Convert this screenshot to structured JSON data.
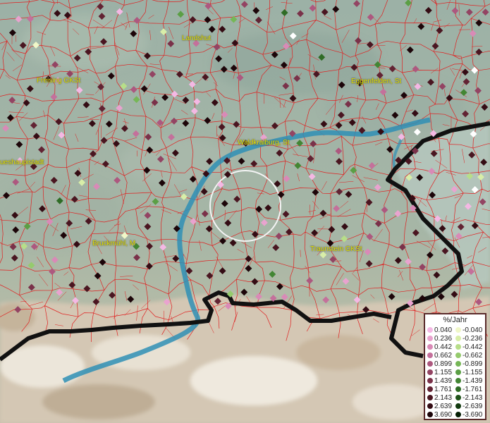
{
  "map": {
    "places": [
      {
        "name": "Landshut"
      },
      {
        "name": "Freising GKSt"
      },
      {
        "name": "Eggenfelden, St"
      },
      {
        "name": "Waldkraiburg, St"
      },
      {
        "name": "ueshaupistadt"
      },
      {
        "name": "Bruckmühl, M"
      },
      {
        "name": "Traunstein GKSt"
      }
    ],
    "colors": {
      "district_lines": "#e02020",
      "river": "#2f8fb5",
      "border": "#111111",
      "label": "#e6e600"
    }
  },
  "legend": {
    "title": "%/Jahr",
    "positive": [
      {
        "label": "0.040",
        "color": "#f4b8e4"
      },
      {
        "label": "0.236",
        "color": "#e9a3cf"
      },
      {
        "label": "0.442",
        "color": "#d98ab7"
      },
      {
        "label": "0.662",
        "color": "#c4709b"
      },
      {
        "label": "0.899",
        "color": "#ad587f"
      },
      {
        "label": "1.155",
        "color": "#934463"
      },
      {
        "label": "1.439",
        "color": "#7a3149"
      },
      {
        "label": "1.761",
        "color": "#622333"
      },
      {
        "label": "2.143",
        "color": "#4a1621"
      },
      {
        "label": "2.639",
        "color": "#340c14"
      },
      {
        "label": "3.690",
        "color": "#1c0509"
      }
    ],
    "negative": [
      {
        "label": "-0.040",
        "color": "#f0f7c8"
      },
      {
        "label": "-0.236",
        "color": "#d8eea8"
      },
      {
        "label": "-0.442",
        "color": "#b7de89"
      },
      {
        "label": "-0.662",
        "color": "#95cb6d"
      },
      {
        "label": "-0.899",
        "color": "#76b757"
      },
      {
        "label": "-1.155",
        "color": "#5b9f45"
      },
      {
        "label": "-1.439",
        "color": "#438634"
      },
      {
        "label": "-1.761",
        "color": "#2f6c26"
      },
      {
        "label": "-2.143",
        "color": "#1f531a"
      },
      {
        "label": "-2.639",
        "color": "#113a0f"
      },
      {
        "label": "-3.690",
        "color": "#051f05"
      }
    ]
  }
}
